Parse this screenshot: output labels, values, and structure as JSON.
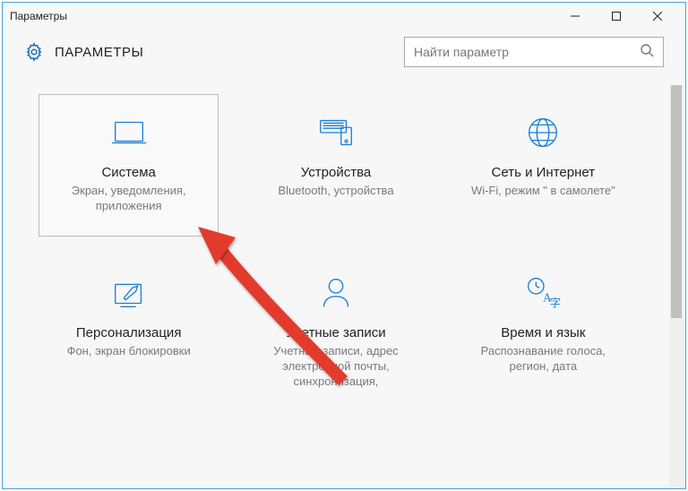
{
  "window": {
    "title": "Параметры"
  },
  "header": {
    "title": "ПАРАМЕТРЫ"
  },
  "search": {
    "placeholder": "Найти параметр"
  },
  "tiles": [
    {
      "title": "Система",
      "sub": "Экран, уведомления, приложения"
    },
    {
      "title": "Устройства",
      "sub": "Bluetooth, устройства"
    },
    {
      "title": "Сеть и Интернет",
      "sub": "Wi-Fi, режим \" в самолете\""
    },
    {
      "title": "Персонализация",
      "sub": "Фон, экран блокировки"
    },
    {
      "title": "Учетные записи",
      "sub": "Учетные записи, адрес электронной почты, синхронизация,"
    },
    {
      "title": "Время и язык",
      "sub": "Распознавание голоса, регион, дата"
    }
  ]
}
